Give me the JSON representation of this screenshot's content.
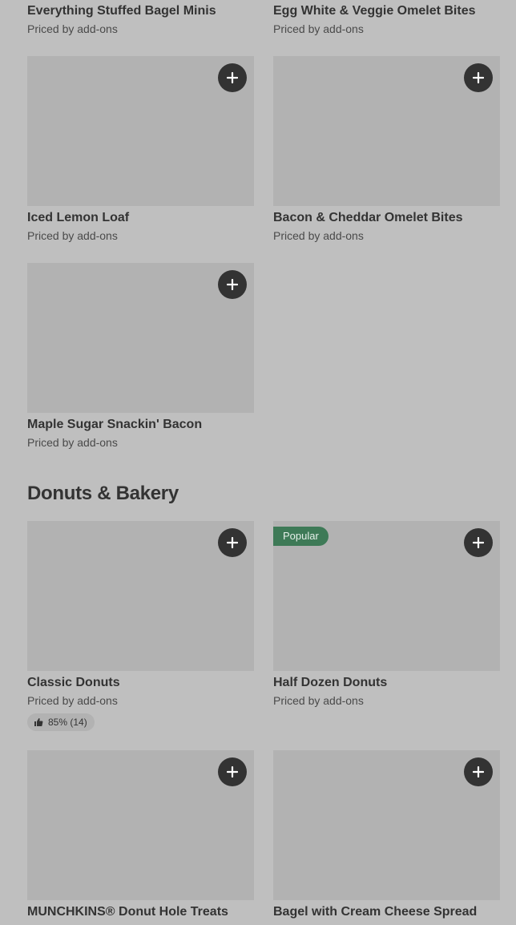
{
  "partial_items": [
    {
      "name": "Everything Stuffed Bagel Minis",
      "price": "Priced by add-ons"
    },
    {
      "name": "Egg White & Veggie Omelet Bites",
      "price": "Priced by add-ons"
    }
  ],
  "items": [
    {
      "name": "Iced Lemon Loaf",
      "price": "Priced by add-ons"
    },
    {
      "name": "Bacon & Cheddar Omelet Bites",
      "price": "Priced by add-ons"
    },
    {
      "name": "Maple Sugar Snackin' Bacon",
      "price": "Priced by add-ons"
    }
  ],
  "section": {
    "title": "Donuts & Bakery",
    "items": [
      {
        "name": "Classic Donuts",
        "price": "Priced by add-ons",
        "rating": "85% (14)"
      },
      {
        "name": "Half Dozen Donuts",
        "price": "Priced by add-ons",
        "badge": "Popular"
      },
      {
        "name": "MUNCHKINS® Donut Hole Treats"
      },
      {
        "name": "Bagel with Cream Cheese Spread"
      }
    ]
  },
  "colors": {
    "background": "#bfbfbf",
    "placeholder": "#b2b2b2",
    "add_button": "#333333",
    "popular_badge": "#3e7a57"
  },
  "icons": {
    "add": "plus-icon",
    "rating": "thumbs-up-icon"
  }
}
